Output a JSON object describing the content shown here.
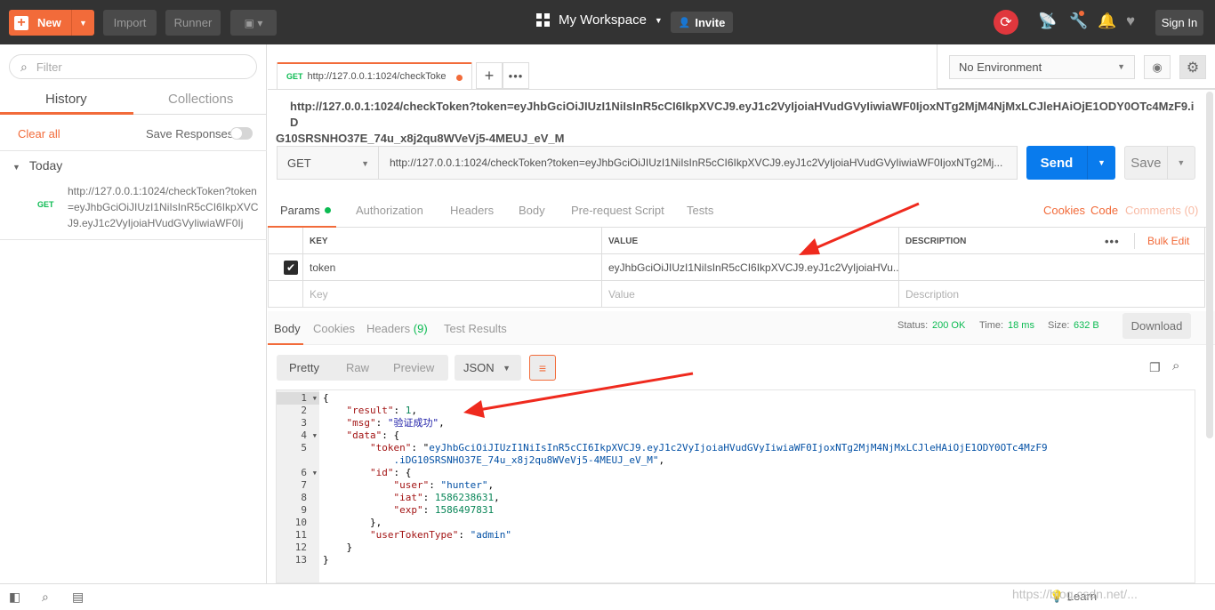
{
  "topbar": {
    "new_label": "New",
    "import_label": "Import",
    "runner_label": "Runner",
    "workspace_label": "My Workspace",
    "invite_label": "Invite",
    "signin_label": "Sign In"
  },
  "sidebar": {
    "filter_placeholder": "Filter",
    "tabs": [
      {
        "label": "History"
      },
      {
        "label": "Collections"
      }
    ],
    "clear_all": "Clear all",
    "save_responses": "Save Responses",
    "group_label": "Today",
    "history": [
      {
        "method": "GET",
        "url": "http://127.0.0.1:1024/checkToken?token=eyJhbGciOiJIUzI1NiIsInR5cCI6IkpXVCJ9.eyJ1c2VyIjoiaHVudGVyIiwiaWF0Ij"
      }
    ]
  },
  "request_tab": {
    "method": "GET",
    "label": "http://127.0.0.1:1024/checkToke"
  },
  "environment": {
    "selected": "No Environment"
  },
  "request": {
    "title_line1": "http://127.0.0.1:1024/checkToken?token=eyJhbGciOiJIUzI1NiIsInR5cCI6IkpXVCJ9.eyJ1c2VyIjoiaHVudGVyIiwiaWF0IjoxNTg2MjM4NjMxLCJleHAiOjE1ODY0OTc4MzF9.iD",
    "title_line2": "G10SRSNHO37E_74u_x8j2qu8WVeVj5-4MEUJ_eV_M",
    "method": "GET",
    "url": "http://127.0.0.1:1024/checkToken?token=eyJhbGciOiJIUzI1NiIsInR5cCI6IkpXVCJ9.eyJ1c2VyIjoiaHVudGVyIiwiaWF0IjoxNTg2Mj...",
    "send_label": "Send",
    "save_label": "Save"
  },
  "param_tabs": {
    "tabs": [
      "Params",
      "Authorization",
      "Headers",
      "Body",
      "Pre-request Script",
      "Tests"
    ],
    "cookies": "Cookies",
    "code": "Code",
    "comments": "Comments (0)"
  },
  "params_table": {
    "headers": {
      "key": "KEY",
      "value": "VALUE",
      "description": "DESCRIPTION"
    },
    "bulk_edit": "Bulk Edit",
    "rows": [
      {
        "key": "token",
        "value": "eyJhbGciOiJIUzI1NiIsInR5cCI6IkpXVCJ9.eyJ1c2VyIjoiaHVu...",
        "checked": true
      }
    ],
    "placeholders": {
      "key": "Key",
      "value": "Value",
      "description": "Description"
    }
  },
  "response": {
    "tabs": [
      "Body",
      "Cookies",
      "Headers",
      "Test Results"
    ],
    "headers_count": "(9)",
    "status_label": "Status:",
    "status_value": "200 OK",
    "time_label": "Time:",
    "time_value": "18 ms",
    "size_label": "Size:",
    "size_value": "632 B",
    "download_label": "Download",
    "formats": [
      "Pretty",
      "Raw",
      "Preview"
    ],
    "language": "JSON"
  },
  "code_lines": [
    "{",
    "    \"result\": 1,",
    "    \"msg\": \"验证成功\",",
    "    \"data\": {",
    "        \"token\": \"eyJhbGciOiJIUzI1NiIsInR5cCI6IkpXVCJ9.eyJ1c2VyIjoiaHVudGVyIiwiaWF0IjoxNTg2MjM4NjMxLCJleHAiOjE1ODY0OTc4MzF9",
    "            .iDG10SRSNHO37E_74u_x8j2qu8WVeVj5-4MEUJ_eV_M\",",
    "        \"id\": {",
    "            \"user\": \"hunter\",",
    "            \"iat\": 1586238631,",
    "            \"exp\": 1586497831",
    "        },",
    "        \"userTokenType\": \"admin\"",
    "    }",
    "}"
  ],
  "line_numbers": [
    "1",
    "2",
    "3",
    "4",
    "5",
    "",
    "6",
    "7",
    "8",
    "9",
    "10",
    "11",
    "12",
    "13"
  ],
  "watermark": "https://blog.csdn.net/...",
  "statusbar": {
    "learn": "Learn"
  }
}
